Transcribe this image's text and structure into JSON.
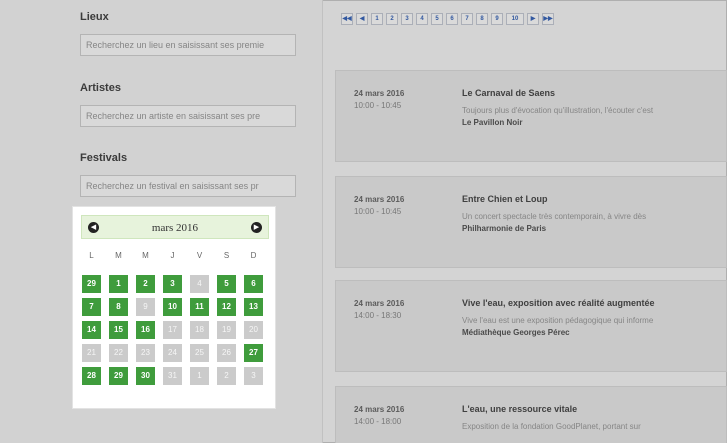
{
  "filters": {
    "places": {
      "label": "Lieux",
      "placeholder": "Recherchez un lieu en saisissant ses premie"
    },
    "artists": {
      "label": "Artistes",
      "placeholder": "Recherchez un artiste en saisissant ses pre"
    },
    "festivals": {
      "label": "Festivals",
      "placeholder": "Recherchez un festival en saisissant ses pr"
    }
  },
  "calendar": {
    "month_label": "mars 2016",
    "weekdays": [
      "L",
      "M",
      "M",
      "J",
      "V",
      "S",
      "D"
    ],
    "weeks": [
      [
        {
          "d": "29",
          "a": true
        },
        {
          "d": "1",
          "a": true
        },
        {
          "d": "2",
          "a": true
        },
        {
          "d": "3",
          "a": true
        },
        {
          "d": "4",
          "a": false
        },
        {
          "d": "5",
          "a": true
        },
        {
          "d": "6",
          "a": true
        }
      ],
      [
        {
          "d": "7",
          "a": true
        },
        {
          "d": "8",
          "a": true
        },
        {
          "d": "9",
          "a": false
        },
        {
          "d": "10",
          "a": true
        },
        {
          "d": "11",
          "a": true
        },
        {
          "d": "12",
          "a": true
        },
        {
          "d": "13",
          "a": true
        }
      ],
      [
        {
          "d": "14",
          "a": true
        },
        {
          "d": "15",
          "a": true
        },
        {
          "d": "16",
          "a": true
        },
        {
          "d": "17",
          "a": false
        },
        {
          "d": "18",
          "a": false
        },
        {
          "d": "19",
          "a": false
        },
        {
          "d": "20",
          "a": false
        }
      ],
      [
        {
          "d": "21",
          "a": false
        },
        {
          "d": "22",
          "a": false
        },
        {
          "d": "23",
          "a": false
        },
        {
          "d": "24",
          "a": false
        },
        {
          "d": "25",
          "a": false
        },
        {
          "d": "26",
          "a": false
        },
        {
          "d": "27",
          "a": true
        }
      ],
      [
        {
          "d": "28",
          "a": true
        },
        {
          "d": "29",
          "a": true
        },
        {
          "d": "30",
          "a": true
        },
        {
          "d": "31",
          "a": false
        },
        {
          "d": "1",
          "a": false
        },
        {
          "d": "2",
          "a": false
        },
        {
          "d": "3",
          "a": false
        }
      ]
    ],
    "colors": {
      "available": "#3f9c3c",
      "unavailable": "#cbcbcb",
      "header": "#e7f3dc"
    }
  },
  "pagination": {
    "first": "◀◀",
    "prev": "◀",
    "pages": [
      "1",
      "2",
      "3",
      "4",
      "5",
      "6",
      "7",
      "8",
      "9",
      "10"
    ],
    "next": "▶",
    "last": "▶▶"
  },
  "events": [
    {
      "date": "24 mars 2016",
      "time": "10:00 - 10:45",
      "title": "Le Carnaval de Saens",
      "desc": "Toujours plus d'évocation qu'illustration, l'écouter c'est",
      "venue": "Le Pavillon Noir"
    },
    {
      "date": "24 mars 2016",
      "time": "10:00 - 10:45",
      "title": "Entre Chien et Loup",
      "desc": "Un concert spectacle très contemporain, à vivre dès",
      "venue": "Philharmonie de Paris"
    },
    {
      "date": "24 mars 2016",
      "time": "14:00 - 18:30",
      "title": "Vive l'eau, exposition avec réalité augmentée",
      "desc": "Vive l'eau est une exposition pédagogique qui informe",
      "venue": "Médiathèque Georges Pérec"
    },
    {
      "date": "24 mars 2016",
      "time": "14:00 - 18:00",
      "title": "L'eau, une ressource vitale",
      "desc": "Exposition de la fondation GoodPlanet, portant sur",
      "venue": ""
    }
  ]
}
